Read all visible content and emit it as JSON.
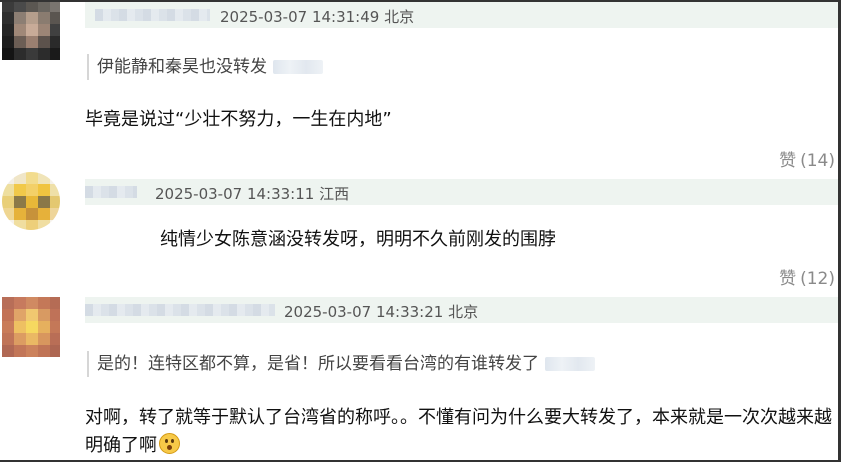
{
  "comments": [
    {
      "timestamp": "2025-03-07 14:31:49",
      "location": "北京",
      "quote": "伊能静和秦昊也没转发",
      "text": "毕竟是说过“少壮不努力，一生在内地”",
      "like_label": "赞",
      "like_count": "(14)"
    },
    {
      "timestamp": "2025-03-07 14:33:11",
      "location": "江西",
      "text": "纯情少女陈意涵没转发呀，明明不久前刚发的围脖",
      "like_label": "赞",
      "like_count": "(12)"
    },
    {
      "timestamp": "2025-03-07 14:33:21",
      "location": "北京",
      "quote": "是的！连特区都不算，是省！所以要看看台湾的有谁转发了",
      "text": "对啊，转了就等于默认了台湾省的称呼。。不懂有问为什么要大转发了，本来就是一次次越来越明确了啊",
      "emoji": "astonished-face-emoji"
    }
  ],
  "colors": {
    "header_bar": "#eef4f0",
    "like_text": "#8a8a8a",
    "meta_text": "#555555"
  }
}
